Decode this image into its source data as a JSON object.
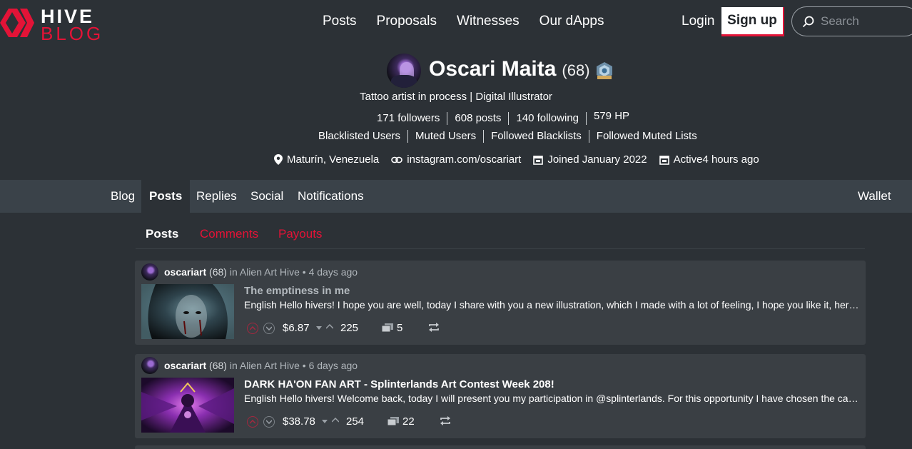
{
  "brand": {
    "line1": "HIVE",
    "line2": "BLOG"
  },
  "nav": [
    "Posts",
    "Proposals",
    "Witnesses",
    "Our dApps"
  ],
  "auth": {
    "login": "Login",
    "signup": "Sign up"
  },
  "search": {
    "placeholder": "Search"
  },
  "profile": {
    "name": "Oscari Maita",
    "reputation": "(68)",
    "about": "Tattoo artist in process | Digital Illustrator",
    "stats": {
      "followers": "171 followers",
      "posts": "608 posts",
      "following": "140 following",
      "hp": "579 HP"
    },
    "lists": [
      "Blacklisted Users",
      "Muted Users",
      "Followed Blacklists",
      "Followed Muted Lists"
    ],
    "location": "Maturín, Venezuela",
    "website": "instagram.com/oscariart",
    "joined": "Joined January 2022",
    "active": "Active4 hours ago"
  },
  "tabs": [
    "Blog",
    "Posts",
    "Replies",
    "Social",
    "Notifications"
  ],
  "active_tab": "Posts",
  "wallet": "Wallet",
  "subtabs": [
    "Posts",
    "Comments",
    "Payouts"
  ],
  "posts": [
    {
      "author": "oscariart",
      "rep": "(68)",
      "community": "in Alien Art Hive",
      "time": "• 4 days ago",
      "title": "The emptiness in me",
      "excerpt": "English Hello hivers! I hope you are well, today I share with you a new illustration, which I made with a lot of feeling, I hope you like it, here I leave you the process...",
      "payout": "$6.87",
      "votes": "225",
      "comments": "5"
    },
    {
      "author": "oscariart",
      "rep": "(68)",
      "community": "in Alien Art Hive",
      "time": "• 6 days ago",
      "title": "DARK HA'ON FAN ART - Splinterlands Art Contest Week 208!",
      "excerpt": "English Hello hivers! Welcome back, today I will present you my participation in @splinterlands. For this opportunity I have chosen the card of Dark Ha'on...",
      "payout": "$38.78",
      "votes": "254",
      "comments": "22"
    }
  ],
  "colors": {
    "bg": "#2c3136",
    "card": "#3a3f44",
    "tabbar": "#3a4249",
    "accent": "#e31337"
  }
}
